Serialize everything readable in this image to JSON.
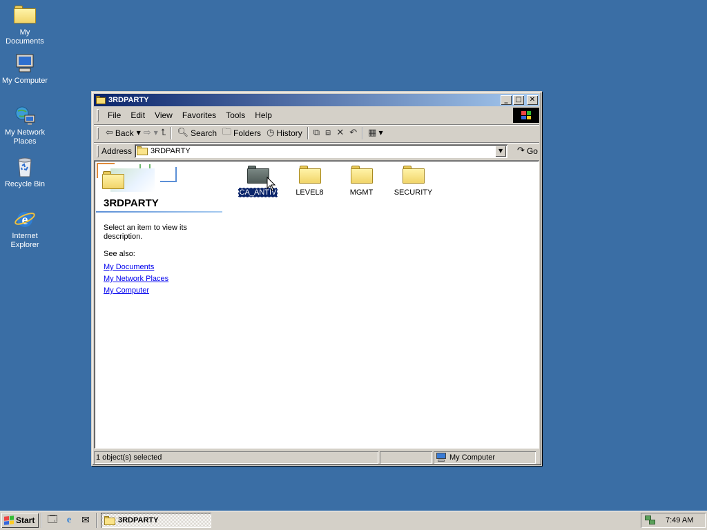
{
  "desktop": {
    "icons": [
      {
        "label": "My Documents"
      },
      {
        "label": "My Computer"
      },
      {
        "label": "My Network Places"
      },
      {
        "label": "Recycle Bin"
      },
      {
        "label": "Internet Explorer"
      }
    ]
  },
  "window": {
    "title": "3RDPARTY",
    "controls": {
      "minimize": "_",
      "maximize": "□",
      "close": "✕"
    },
    "menu": [
      "File",
      "Edit",
      "View",
      "Favorites",
      "Tools",
      "Help"
    ],
    "toolbar": {
      "back": "Back",
      "search": "Search",
      "folders": "Folders",
      "history": "History"
    },
    "address": {
      "label": "Address",
      "value": "3RDPARTY",
      "go": "Go"
    },
    "webview": {
      "title": "3RDPARTY",
      "description": "Select an item to view its description.",
      "see_also": "See also:",
      "links": [
        "My Documents",
        "My Network Places",
        "My Computer"
      ]
    },
    "files": [
      {
        "name": "CA_ANTIV",
        "selected": true
      },
      {
        "name": "LEVEL8",
        "selected": false
      },
      {
        "name": "MGMT",
        "selected": false
      },
      {
        "name": "SECURITY",
        "selected": false
      }
    ],
    "status": {
      "selection": "1 object(s) selected",
      "zone": "My Computer"
    }
  },
  "taskbar": {
    "start": "Start",
    "task": "3RDPARTY",
    "clock": "7:49 AM"
  },
  "colors": {
    "desktop": "#3a6ea5",
    "titlebar_start": "#0a246a",
    "titlebar_end": "#a6caf0",
    "selection": "#0a246a",
    "link": "#0000ee"
  }
}
